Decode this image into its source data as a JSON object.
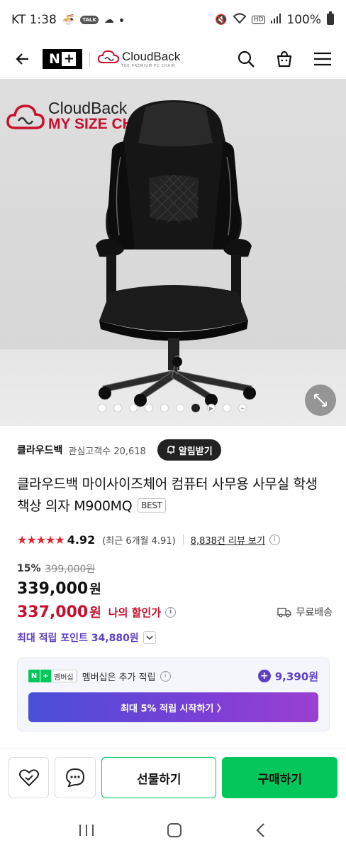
{
  "status_bar": {
    "carrier_time": "KT 1:38",
    "talk_badge": "TALK",
    "battery": "100%"
  },
  "app_bar": {
    "nplus_label": "N",
    "nplus_plus": "+",
    "brand_name": "CloudBack",
    "brand_sub": "THE PREMIUM PC CHAIR"
  },
  "hero": {
    "logo_line1": "CloudBack",
    "logo_line2": "MY SIZE CHAIR",
    "total_slides": 10,
    "active_slide": 7
  },
  "store": {
    "name": "클라우드백",
    "fav_label": "관심고객수 20,618",
    "alarm_button": "알림받기"
  },
  "product": {
    "title": "클라우드백 마이사이즈체어 컴퓨터 사무용 사무실 학생 책상 의자 M900MQ",
    "badge": "BEST"
  },
  "rating": {
    "stars": "★★★★★",
    "score": "4.92",
    "recent": "(최근 6개월 4.91)",
    "review_link": "8,838건 리뷰 보기"
  },
  "price": {
    "discount_pct": "15%",
    "original": "399,000원",
    "sale": "339,000",
    "sale_unit": "원",
    "my_price": "337,000",
    "my_unit": "원",
    "my_label": "나의 할인가",
    "shipping": "무료배송",
    "points": "최대 적립 포인트 34,880원"
  },
  "membership": {
    "badge_n": "N",
    "badge_plus": "+",
    "badge_text": "멤버십",
    "text": "멤버십은 추가 적립",
    "points": "9,390원",
    "cta": "최대 5% 적립 시작하기 〉"
  },
  "bottom_bar": {
    "gift_label": "선물하기",
    "buy_label": "구매하기"
  },
  "colors": {
    "accent_green": "#03c75a",
    "price_red": "#c8102e",
    "purple": "#5d3fc7"
  }
}
